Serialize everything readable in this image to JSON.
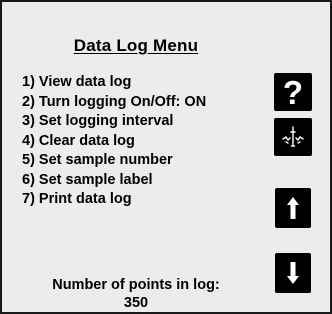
{
  "menu": {
    "title": "Data Log Menu",
    "items": [
      {
        "label": "1) View data log"
      },
      {
        "label": "2) Turn logging On/Off: ON"
      },
      {
        "label": "3) Set logging interval"
      },
      {
        "label": "4) Clear data log"
      },
      {
        "label": "5) Set sample number"
      },
      {
        "label": "6) Set sample label"
      },
      {
        "label": "7) Print data log"
      }
    ]
  },
  "log_status": {
    "label": "Number of points in log:",
    "count": "350"
  },
  "softkeys": {
    "help": {
      "glyph": "?",
      "icon": "help-icon"
    },
    "probe": {
      "icon": "probe-icon"
    },
    "up": {
      "icon": "arrow-up-icon"
    },
    "down": {
      "icon": "arrow-down-icon"
    }
  },
  "colors": {
    "screen_background": "#ececec",
    "text": "#000000",
    "softkey_background": "#000000",
    "softkey_glyph": "#ffffff"
  }
}
